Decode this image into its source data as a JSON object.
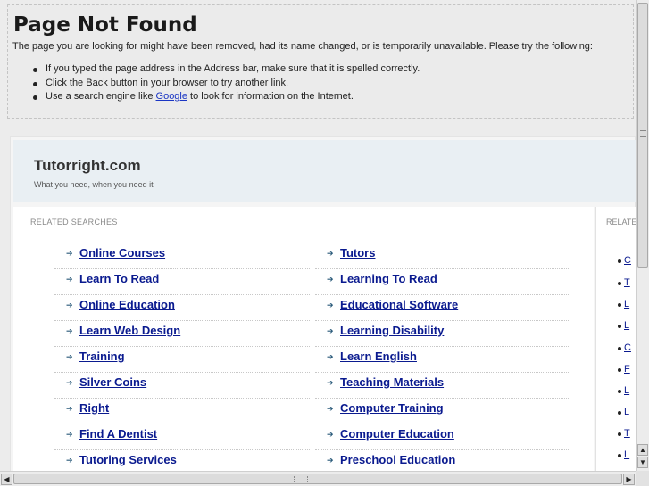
{
  "error": {
    "title": "Page Not Found",
    "message": "The page you are looking for might have been removed, had its name changed, or is temporarily unavailable. Please try the following:",
    "tips": [
      "If you typed the page address in the Address bar, make sure that it is spelled correctly.",
      "Click the Back button in your browser to try another link."
    ],
    "tip3_before": "Use a search engine like ",
    "tip3_link": "Google",
    "tip3_after": " to look for information on the Internet."
  },
  "parked": {
    "site_title": "Tutorright.com",
    "tagline": "What you need, when you need it",
    "related_label": "RELATED SEARCHES",
    "right_label": "RELATE",
    "left_links": [
      "Online Courses",
      "Learn To Read",
      "Online Education",
      "Learn Web Design",
      "Training",
      "Silver Coins",
      "Right",
      "Find A Dentist",
      "Tutoring Services"
    ],
    "right_links": [
      "Tutors",
      "Learning To Read",
      "Educational Software",
      "Learning Disability",
      "Learn English",
      "Teaching Materials",
      "Computer Training",
      "Computer Education",
      "Preschool Education"
    ],
    "right_panel_items": [
      "C",
      "T",
      "L",
      "L",
      "C",
      "F",
      "L",
      "L",
      "T",
      "L"
    ]
  },
  "icons": {
    "link_arrow": "arrow-right-icon",
    "scroll_up": "scroll-up-arrow",
    "scroll_down": "scroll-down-arrow",
    "scroll_left": "scroll-left-arrow",
    "scroll_right": "scroll-right-arrow"
  },
  "colors": {
    "link": "#0a1a8f",
    "header_bg": "#e9eff3",
    "page_bg": "#ececec"
  }
}
